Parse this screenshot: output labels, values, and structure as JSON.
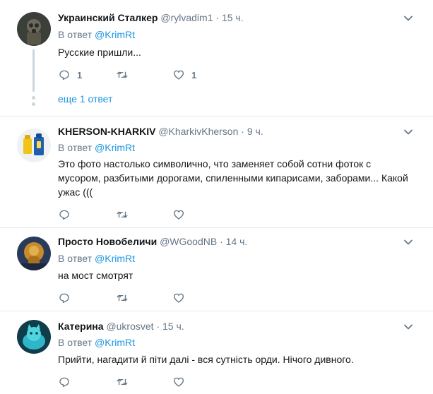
{
  "separator": "·",
  "tweets": [
    {
      "name": "Украинский Сталкер",
      "handle": "@rylvadim1",
      "time": "15 ч.",
      "reply_prefix": "В ответ",
      "reply_mention": "@KrimRt",
      "text": "Русские пришли...",
      "reply_count": "1",
      "retweet_count": "",
      "like_count": "1",
      "more_replies": "еще 1 ответ"
    },
    {
      "name": "KHERSON-KHARKIV",
      "handle": "@KharkivKherson",
      "time": "9 ч.",
      "reply_prefix": "В ответ",
      "reply_mention": "@KrimRt",
      "text": "Это фото настолько символично, что заменяет собой сотни фоток с мусором, разбитыми дорогами, спиленными кипарисами, заборами... Какой ужас (((",
      "reply_count": "",
      "retweet_count": "",
      "like_count": ""
    },
    {
      "name": "Просто Новобеличи",
      "handle": "@WGoodNB",
      "time": "14 ч.",
      "reply_prefix": "В ответ",
      "reply_mention": "@KrimRt",
      "text": "на мост смотрят",
      "reply_count": "",
      "retweet_count": "",
      "like_count": ""
    },
    {
      "name": "Катерина",
      "handle": "@ukrosvet",
      "time": "15 ч.",
      "reply_prefix": "В ответ",
      "reply_mention": "@KrimRt",
      "text": "Прийти, нагадити й піти далі - вся сутність орди. Нічого дивного.",
      "reply_count": "",
      "retweet_count": "",
      "like_count": ""
    }
  ],
  "icons": {
    "reply": "reply-icon",
    "retweet": "retweet-icon",
    "like": "heart-icon",
    "caret": "chevron-down-icon"
  },
  "colors": {
    "link": "#1b95e0",
    "secondary_text": "#657786",
    "icon": "#657786",
    "divider": "#e6ecf0",
    "thread_line": "#ccd6dd"
  }
}
